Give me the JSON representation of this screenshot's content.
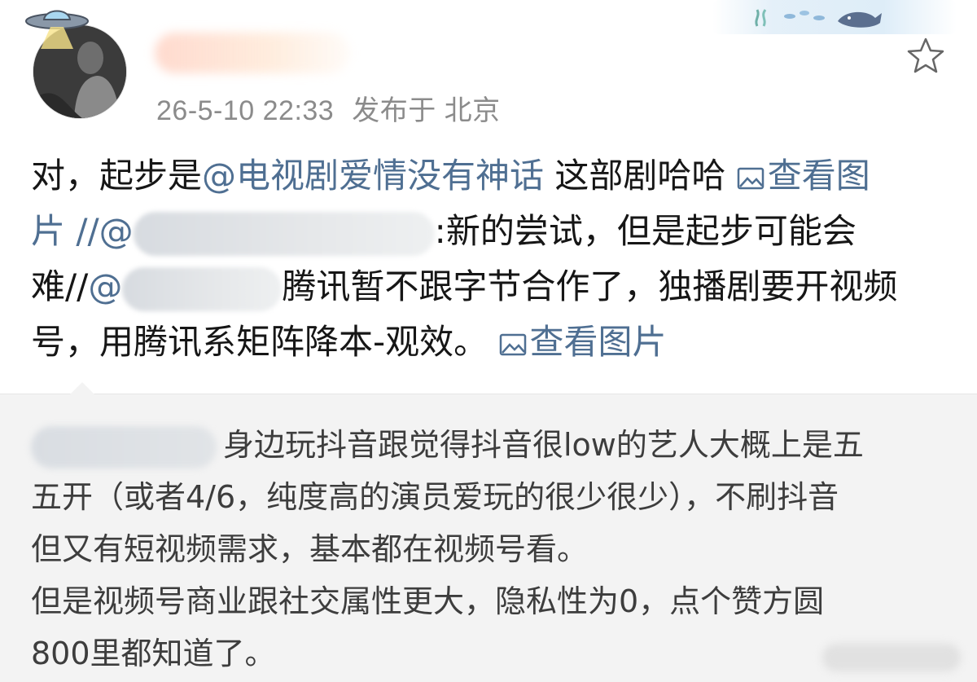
{
  "post": {
    "timestamp": "26-5-10 22:33",
    "location": "发布于 北京",
    "lines": [
      {
        "t1": "对，起步是",
        "mention": "@电视剧爱情没有神话",
        "t2": " 这部剧哈哈 ",
        "img": "查看图"
      },
      {
        "t1": "片",
        "t2": "  //@",
        "t3": ":新的尝试，但是起步可能会"
      },
      {
        "t1": "难//",
        "mention": "@",
        "t2": "腾讯暂不跟字节合作了，独播剧要开视频"
      },
      {
        "t1": "号，用腾讯系矩阵降本-观效。 ",
        "img": "查看图片"
      }
    ]
  },
  "quote": {
    "lines": [
      "身边玩抖音跟觉得抖音很low的艺人大概上是五",
      "五开（或者4/6，纯度高的演员爱玩的很少很少），不刷抖音",
      "但又有短视频需求，基本都在视频号看。",
      "但是视频号商业跟社交属性更大，隐私性为0，点个赞方圆",
      "800里都知道了。"
    ]
  },
  "icons": {
    "favorite": "star-outline-icon",
    "view_image": "image-icon",
    "badge": "ufo-icon"
  },
  "colors": {
    "link": "#4f6f92",
    "meta": "#8b8b8b",
    "quote_bg": "#f3f3f3"
  }
}
